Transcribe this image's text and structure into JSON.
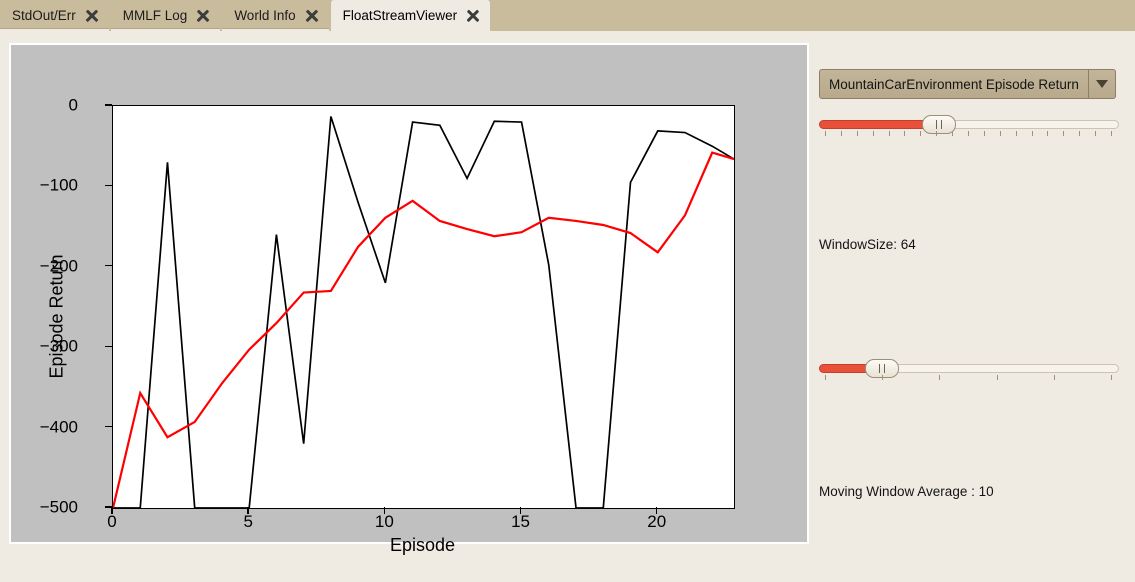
{
  "window": {
    "background_color": "#EFEAE2",
    "tabbar_color": "#C9BC9C"
  },
  "tabs": [
    {
      "label": "StdOut/Err",
      "active": false,
      "close_icon": "close-icon"
    },
    {
      "label": "MMLF Log",
      "active": false,
      "close_icon": "close-icon"
    },
    {
      "label": "World Info",
      "active": false,
      "close_icon": "close-icon"
    },
    {
      "label": "FloatStreamViewer",
      "active": true,
      "close_icon": "close-icon"
    }
  ],
  "controls": {
    "stream_select": {
      "selected": "MountainCarEnvironment Episode Return",
      "arrow_icon": "chevron-down-icon"
    },
    "slider_top": {
      "value_percent": 40,
      "tick_count": 19,
      "fill_color": "#E8503A",
      "handle_icon": "slider-handle-grip"
    },
    "window_size_label": "WindowSize: 64",
    "slider_bottom": {
      "value_percent": 21,
      "tick_count": 6,
      "fill_color": "#E8503A",
      "handle_icon": "slider-handle-grip"
    },
    "moving_window_average_label": "Moving Window Average : 10"
  },
  "chart_data": {
    "type": "line",
    "title": "",
    "xlabel": "Episode",
    "ylabel": "Episode Return",
    "xlim": [
      0,
      22.8
    ],
    "ylim": [
      -500,
      0
    ],
    "xticks": [
      0,
      5,
      10,
      15,
      20
    ],
    "yticks": [
      0,
      -100,
      -200,
      -300,
      -400,
      -500
    ],
    "grid": false,
    "legend": "none",
    "figure_facecolor": "#C0C0C0",
    "axes_facecolor": "#FFFFFF",
    "x": [
      0,
      1,
      2,
      3,
      4,
      5,
      6,
      7,
      8,
      9,
      10,
      11,
      12,
      13,
      14,
      15,
      16,
      17,
      18,
      19,
      20,
      21,
      22,
      22.8
    ],
    "series": [
      {
        "name": "Episode Return",
        "color": "#000000",
        "values": [
          -500,
          -500,
          -70,
          -500,
          -500,
          -500,
          -160,
          -420,
          -13,
          -120,
          -220,
          -20,
          -24,
          -90,
          -19,
          -20,
          -198,
          -500,
          -500,
          -95,
          -31,
          -33,
          -50,
          -66
        ]
      },
      {
        "name": "Moving Window Average",
        "color": "#FF0000",
        "values": [
          -500,
          -357,
          -412,
          -393,
          -345,
          -303,
          -270,
          -232,
          -230,
          -175,
          -139,
          -118,
          -143,
          -153,
          -162,
          -157,
          -139,
          -143,
          -148,
          -158,
          -182,
          -136,
          -58,
          -66
        ]
      }
    ]
  }
}
